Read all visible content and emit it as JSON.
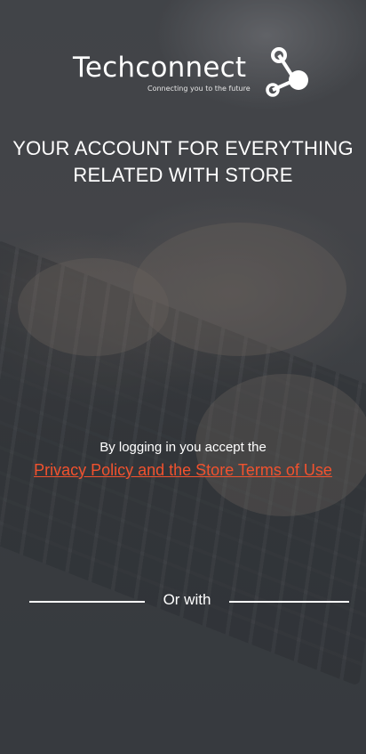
{
  "logo": {
    "name": "Techconnect",
    "tagline": "Connecting you to the future",
    "icon": "network-nodes-icon"
  },
  "headline": {
    "line1": "YOUR ACCOUNT FOR EVERYTHING",
    "line2": "RELATED WITH STORE"
  },
  "legal": {
    "text": "By logging in you accept the",
    "link": "Privacy Policy and the Store Terms of Use"
  },
  "divider": {
    "label": "Or with"
  },
  "colors": {
    "accent": "#f2522e",
    "text": "#ffffff",
    "background": "#45484d"
  }
}
